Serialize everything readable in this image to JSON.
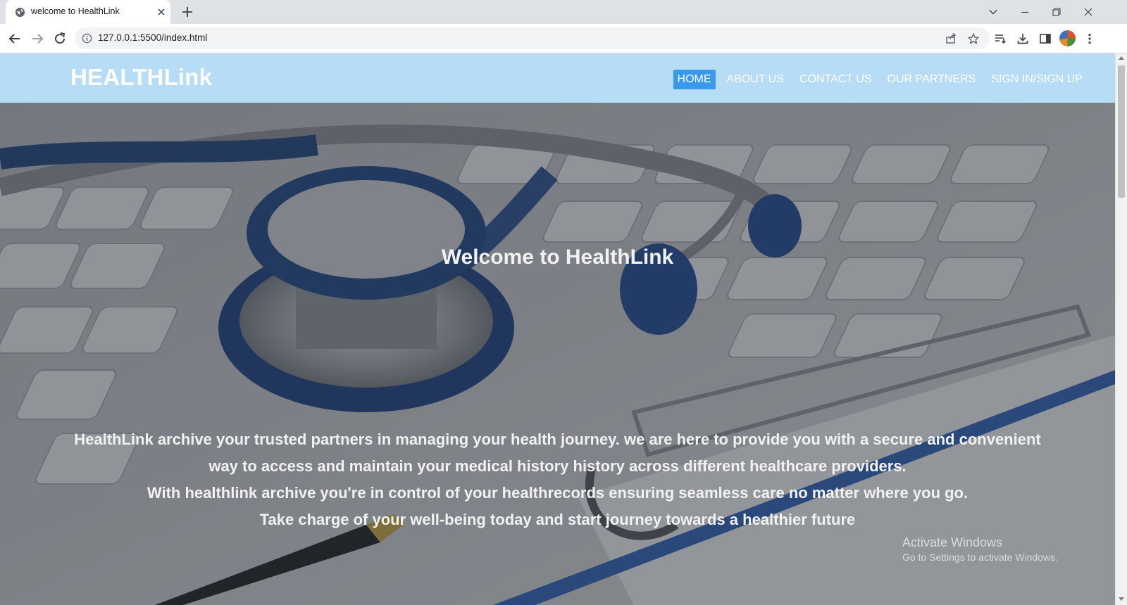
{
  "browser": {
    "tab_title": "welcome to HealthLink",
    "url": "127.0.0.1:5500/index.html"
  },
  "site": {
    "logo": "HEALTHLink",
    "nav": [
      {
        "label": "HOME",
        "active": true
      },
      {
        "label": "ABOUT US",
        "active": false
      },
      {
        "label": "CONTACT US",
        "active": false
      },
      {
        "label": "OUR PARTNERS",
        "active": false
      },
      {
        "label": "SIGN IN/SIGN UP",
        "active": false
      }
    ],
    "nav_active_color": "#3a98ea",
    "header_color": "#b7dcf6"
  },
  "hero": {
    "title": "Welcome to HealthLink",
    "paragraphs": [
      "HealthLink archive your trusted partners in managing your health journey. we are here to provide you with a secure and convenient way to access and maintain your medical history history across different healthcare providers.",
      "With healthlink archive you're in control of your healthrecords ensuring seamless care no matter where you go.",
      "Take charge of your well-being today and start journey towards a healthier future"
    ]
  },
  "watermark": {
    "title": "Activate Windows",
    "subtitle": "Go to Settings to activate Windows."
  },
  "icons": {
    "tab_favicon": "globe-icon",
    "tab_close": "close-icon",
    "new_tab": "plus-icon",
    "back": "back-arrow-icon",
    "forward": "forward-arrow-icon",
    "reload": "reload-icon",
    "site_info": "info-icon",
    "share": "share-icon",
    "bookmark": "star-icon",
    "reading_list": "reading-list-icon",
    "downloads": "download-icon",
    "side_panel": "side-panel-icon",
    "menu": "kebab-menu-icon"
  }
}
